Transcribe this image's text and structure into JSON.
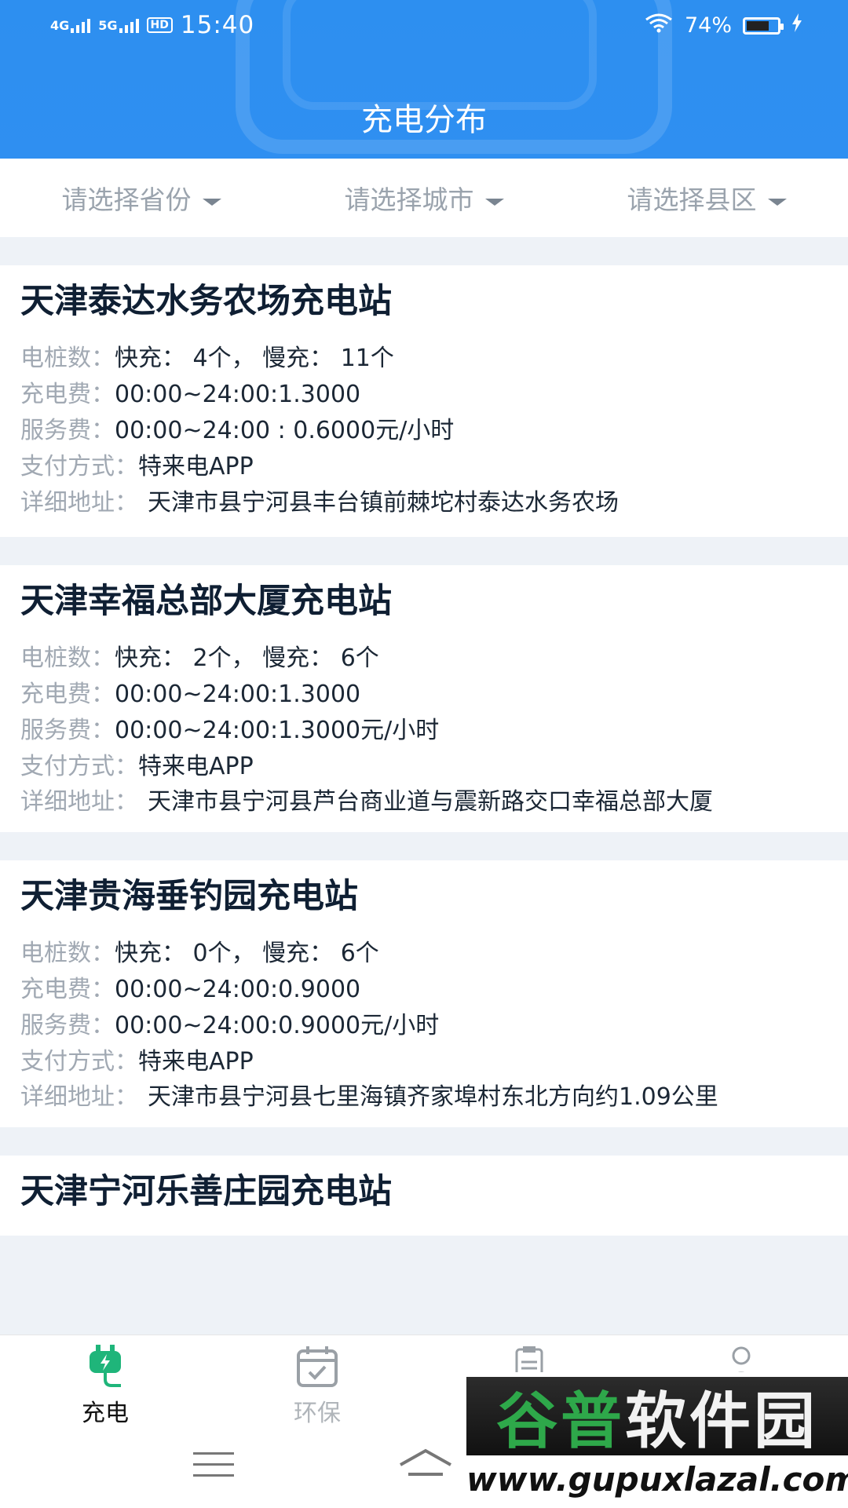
{
  "status_bar": {
    "net1": "4G",
    "net2": "5G",
    "hd": "HD",
    "time": "15:40",
    "battery": "74%",
    "battery_level": 0.74
  },
  "header": {
    "title": "充电分布"
  },
  "filters": [
    {
      "label": "请选择省份"
    },
    {
      "label": "请选择城市"
    },
    {
      "label": "请选择县区"
    }
  ],
  "stations": [
    {
      "name": "天津泰达水务农场充电站",
      "piles_label": "电桩数：",
      "piles": "快充： 4个， 慢充： 11个",
      "fee_label": "充电费：",
      "fee": "00:00~24:00:1.3000",
      "service_label": "服务费：",
      "service": "00:00~24:00 : 0.6000元/小时",
      "pay_label": "支付方式：",
      "pay": "特来电APP",
      "addr_label": "详细地址：",
      "addr": "天津市县宁河县丰台镇前棘坨村泰达水务农场"
    },
    {
      "name": "天津幸福总部大厦充电站",
      "piles_label": "电桩数：",
      "piles": "快充： 2个， 慢充： 6个",
      "fee_label": "充电费：",
      "fee": "00:00~24:00:1.3000",
      "service_label": "服务费：",
      "service": "00:00~24:00:1.3000元/小时",
      "pay_label": "支付方式：",
      "pay": "特来电APP",
      "addr_label": "详细地址：",
      "addr": "天津市县宁河县芦台商业道与震新路交口幸福总部大厦"
    },
    {
      "name": "天津贵海垂钓园充电站",
      "piles_label": "电桩数：",
      "piles": "快充： 0个， 慢充： 6个",
      "fee_label": "充电费：",
      "fee": "00:00~24:00:0.9000",
      "service_label": "服务费：",
      "service": "00:00~24:00:0.9000元/小时",
      "pay_label": "支付方式：",
      "pay": "特来电APP",
      "addr_label": "详细地址：",
      "addr": "天津市县宁河县七里海镇齐家埠村东北方向约1.09公里"
    },
    {
      "name": "天津宁河乐善庄园充电站"
    }
  ],
  "tabs": [
    {
      "label": "充电",
      "icon": "charging-plug-icon",
      "active": true,
      "color": "#1fb57a"
    },
    {
      "label": "环保",
      "icon": "calendar-check-icon",
      "active": false,
      "color": "#9aa0a6"
    },
    {
      "label": "",
      "icon": "clipboard-icon",
      "active": false
    },
    {
      "label": "",
      "icon": "user-icon",
      "active": false
    }
  ],
  "watermark": {
    "top_a": "谷普",
    "top_b": "软件园",
    "bottom": "www.gupuxlazal.com"
  },
  "colors": {
    "header_blue": "#2f8ff1",
    "accent_green": "#1fb57a",
    "title_text": "#0f1f33",
    "label_gray": "#a1a9b3"
  }
}
